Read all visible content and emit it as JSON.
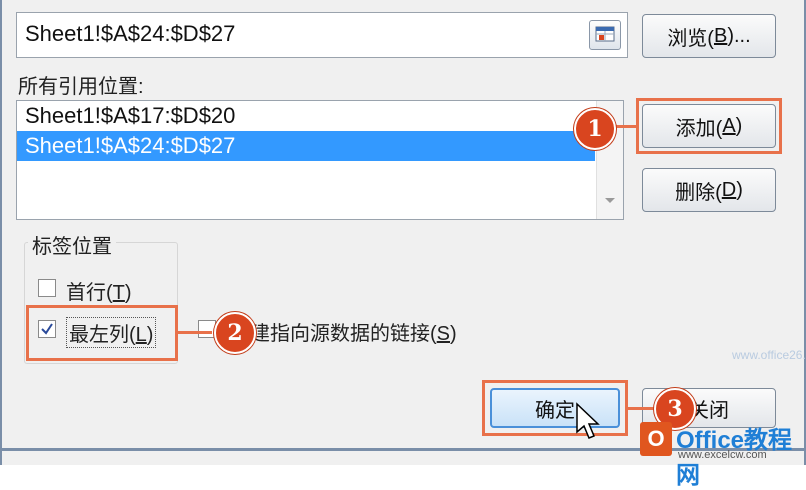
{
  "reference": {
    "value": "Sheet1!$A$24:$D$27"
  },
  "buttons": {
    "browse": {
      "text": "浏览(",
      "key": "B",
      "tail": ")..."
    },
    "add": {
      "text": "添加(",
      "key": "A",
      "tail": ")"
    },
    "delete": {
      "text": "删除(",
      "key": "D",
      "tail": ")"
    },
    "ok": {
      "text": "确定"
    },
    "close": {
      "text": "关闭"
    }
  },
  "all_references": {
    "label": "所有引用位置:",
    "items": [
      "Sheet1!$A$17:$D$20",
      "Sheet1!$A$24:$D$27"
    ],
    "selected_index": 1
  },
  "label_position": {
    "title": "标签位置",
    "top_row": {
      "text": "首行(",
      "key": "T",
      "tail": ")",
      "checked": false
    },
    "left_column": {
      "text": "最左列(",
      "key": "L",
      "tail": ")",
      "checked": true
    }
  },
  "link_source": {
    "text": "建指向源数据的链接(",
    "key": "S",
    "tail": ")",
    "checked": false
  },
  "steps": [
    "1",
    "2",
    "3"
  ],
  "watermark": {
    "logo": "O",
    "text": "Office教程网",
    "url": "www.office26.com",
    "url2": "www.excelcw.com"
  },
  "colors": {
    "highlight": "#e8714a",
    "step_badge": "#d9451f",
    "selection": "#3399ff"
  }
}
